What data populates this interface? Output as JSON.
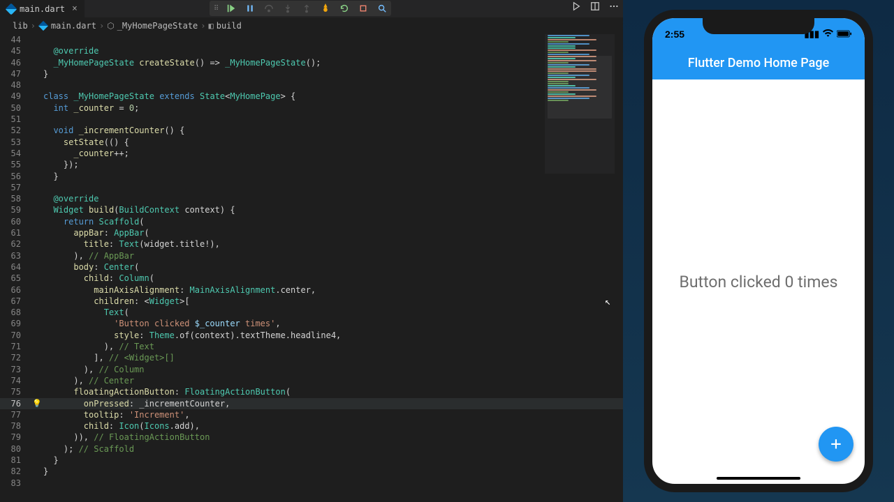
{
  "tab": {
    "filename": "main.dart"
  },
  "breadcrumb": {
    "folder": "lib",
    "file": "main.dart",
    "class": "_MyHomePageState",
    "method": "build"
  },
  "toolbar": {
    "continue": "continue",
    "pause": "pause",
    "step_over": "step over",
    "step_into": "step into",
    "step_out": "step out",
    "hot_reload": "hot reload",
    "restart": "restart",
    "stop": "stop",
    "start": "start debugging",
    "split": "split editor",
    "more": "more"
  },
  "lines": {
    "start": 44,
    "hl": 76,
    "bulb": 76,
    "tokens": [
      [],
      [
        [
          "meta",
          "@override"
        ]
      ],
      [
        [
          "cls",
          "_MyHomePageState"
        ],
        [
          "pun",
          " "
        ],
        [
          "id",
          "createState"
        ],
        [
          "pun",
          "() => "
        ],
        [
          "cls",
          "_MyHomePageState"
        ],
        [
          "pun",
          "();"
        ]
      ],
      [
        [
          "pun",
          "}"
        ]
      ],
      [],
      [
        [
          "kw",
          "class"
        ],
        [
          "pun",
          " "
        ],
        [
          "cls",
          "_MyHomePageState"
        ],
        [
          "pun",
          " "
        ],
        [
          "kw",
          "extends"
        ],
        [
          "pun",
          " "
        ],
        [
          "cls",
          "State"
        ],
        [
          "pun",
          "<"
        ],
        [
          "cls",
          "MyHomePage"
        ],
        [
          "pun",
          "> {"
        ]
      ],
      [
        [
          "pun",
          "  "
        ],
        [
          "kw",
          "int"
        ],
        [
          "pun",
          " "
        ],
        [
          "id",
          "_counter"
        ],
        [
          "pun",
          " = "
        ],
        [
          "num",
          "0"
        ],
        [
          "pun",
          ";"
        ]
      ],
      [],
      [
        [
          "pun",
          "  "
        ],
        [
          "kw",
          "void"
        ],
        [
          "pun",
          " "
        ],
        [
          "id",
          "_incrementCounter"
        ],
        [
          "pun",
          "() {"
        ]
      ],
      [
        [
          "pun",
          "    "
        ],
        [
          "id",
          "setState"
        ],
        [
          "pun",
          "(() {"
        ]
      ],
      [
        [
          "pun",
          "      "
        ],
        [
          "id",
          "_counter"
        ],
        [
          "pun",
          "++;"
        ]
      ],
      [
        [
          "pun",
          "    });"
        ]
      ],
      [
        [
          "pun",
          "  }"
        ]
      ],
      [],
      [
        [
          "pun",
          "  "
        ],
        [
          "meta",
          "@override"
        ]
      ],
      [
        [
          "pun",
          "  "
        ],
        [
          "cls",
          "Widget"
        ],
        [
          "pun",
          " "
        ],
        [
          "id",
          "build"
        ],
        [
          "pun",
          "("
        ],
        [
          "cls",
          "BuildContext"
        ],
        [
          "pun",
          " context) {"
        ]
      ],
      [
        [
          "pun",
          "    "
        ],
        [
          "kw",
          "return"
        ],
        [
          "pun",
          " "
        ],
        [
          "cls",
          "Scaffold"
        ],
        [
          "pun",
          "("
        ]
      ],
      [
        [
          "pun",
          "      "
        ],
        [
          "id",
          "appBar"
        ],
        [
          "pun",
          ": "
        ],
        [
          "cls",
          "AppBar"
        ],
        [
          "pun",
          "("
        ]
      ],
      [
        [
          "pun",
          "        "
        ],
        [
          "id",
          "title"
        ],
        [
          "pun",
          ": "
        ],
        [
          "cls",
          "Text"
        ],
        [
          "pun",
          "(widget.title!),"
        ]
      ],
      [
        [
          "pun",
          "      ), "
        ],
        [
          "cm",
          "// AppBar"
        ]
      ],
      [
        [
          "pun",
          "      "
        ],
        [
          "id",
          "body"
        ],
        [
          "pun",
          ": "
        ],
        [
          "cls",
          "Center"
        ],
        [
          "pun",
          "("
        ]
      ],
      [
        [
          "pun",
          "        "
        ],
        [
          "id",
          "child"
        ],
        [
          "pun",
          ": "
        ],
        [
          "cls",
          "Column"
        ],
        [
          "pun",
          "("
        ]
      ],
      [
        [
          "pun",
          "          "
        ],
        [
          "id",
          "mainAxisAlignment"
        ],
        [
          "pun",
          ": "
        ],
        [
          "cls",
          "MainAxisAlignment"
        ],
        [
          "pun",
          ".center,"
        ]
      ],
      [
        [
          "pun",
          "          "
        ],
        [
          "id",
          "children"
        ],
        [
          "pun",
          ": <"
        ],
        [
          "cls",
          "Widget"
        ],
        [
          "pun",
          ">["
        ]
      ],
      [
        [
          "pun",
          "            "
        ],
        [
          "cls",
          "Text"
        ],
        [
          "pun",
          "("
        ]
      ],
      [
        [
          "pun",
          "              "
        ],
        [
          "str",
          "'Button clicked "
        ],
        [
          "interp",
          "$_counter"
        ],
        [
          "str",
          " times'"
        ],
        [
          "pun",
          ","
        ]
      ],
      [
        [
          "pun",
          "              "
        ],
        [
          "id",
          "style"
        ],
        [
          "pun",
          ": "
        ],
        [
          "cls",
          "Theme"
        ],
        [
          "pun",
          ".of(context).textTheme.headline4,"
        ]
      ],
      [
        [
          "pun",
          "            ), "
        ],
        [
          "cm",
          "// Text"
        ]
      ],
      [
        [
          "pun",
          "          ], "
        ],
        [
          "cm",
          "// <Widget>[]"
        ]
      ],
      [
        [
          "pun",
          "        ), "
        ],
        [
          "cm",
          "// Column"
        ]
      ],
      [
        [
          "pun",
          "      ), "
        ],
        [
          "cm",
          "// Center"
        ]
      ],
      [
        [
          "pun",
          "      "
        ],
        [
          "id",
          "floatingActionButton"
        ],
        [
          "pun",
          ": "
        ],
        [
          "cls",
          "FloatingActionButton"
        ],
        [
          "pun",
          "("
        ]
      ],
      [
        [
          "pun",
          "        "
        ],
        [
          "id",
          "onPressed"
        ],
        [
          "pun",
          ": _incrementCounter,"
        ]
      ],
      [
        [
          "pun",
          "        "
        ],
        [
          "id",
          "tooltip"
        ],
        [
          "pun",
          ": "
        ],
        [
          "str",
          "'Increment'"
        ],
        [
          "pun",
          ","
        ]
      ],
      [
        [
          "pun",
          "        "
        ],
        [
          "id",
          "child"
        ],
        [
          "pun",
          ": "
        ],
        [
          "cls",
          "Icon"
        ],
        [
          "pun",
          "("
        ],
        [
          "cls",
          "Icons"
        ],
        [
          "pun",
          ".add),"
        ]
      ],
      [
        [
          "pun",
          "      )"
        ],
        [
          "pun",
          "), "
        ],
        [
          "cm",
          "// FloatingActionButton"
        ]
      ],
      [
        [
          "pun",
          "    ); "
        ],
        [
          "cm",
          "// Scaffold"
        ]
      ],
      [
        [
          "pun",
          "  }"
        ]
      ],
      [
        [
          "pun",
          "}"
        ]
      ],
      []
    ]
  },
  "phone": {
    "time": "2:55",
    "title": "Flutter Demo Home Page",
    "body_text": "Button clicked 0 times",
    "fab_tooltip": "Increment"
  }
}
